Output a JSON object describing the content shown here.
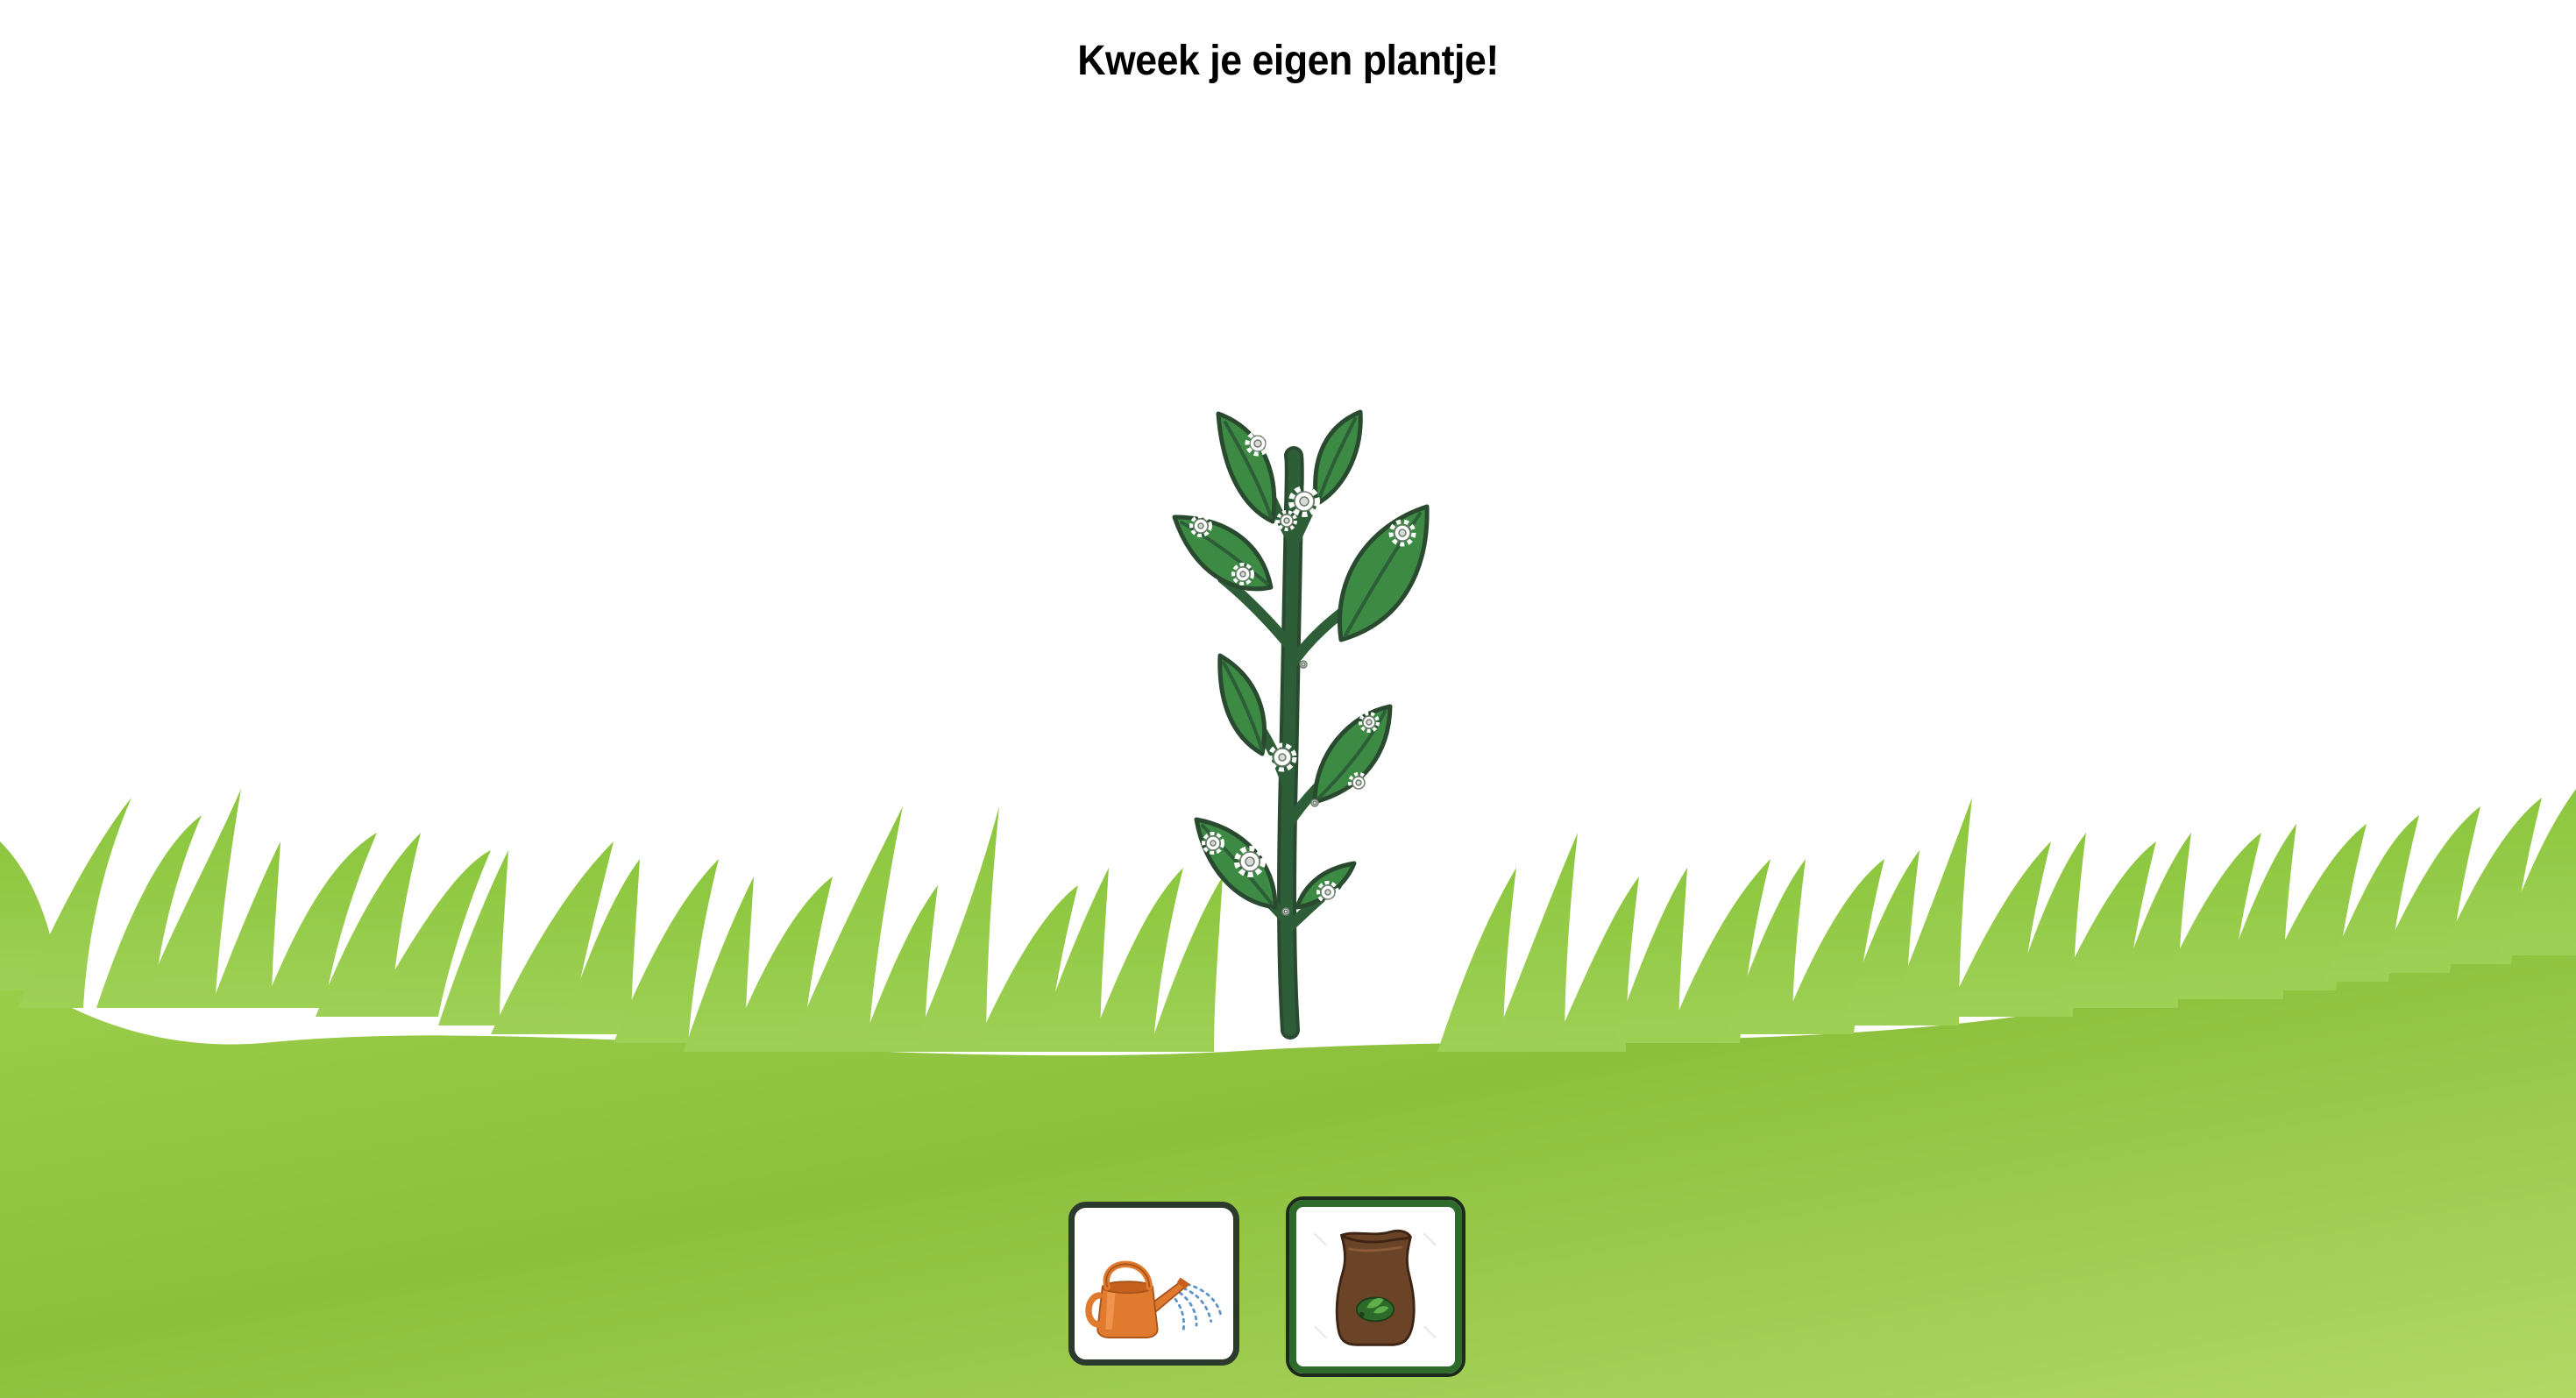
{
  "title": "Kweek je eigen plantje!",
  "colors": {
    "grass_light": "#b4dc6a",
    "grass_dark": "#7fb42c",
    "leaf": "#3d8a45",
    "stem": "#2d5e38",
    "outline": "#2a4a30",
    "flower": "#ffffff",
    "watering_can": "#e07a2e",
    "soil_bag": "#6b4428"
  },
  "tools": [
    {
      "name": "watering-can",
      "icon": "watering-can-icon",
      "selected": false
    },
    {
      "name": "soil-bag",
      "icon": "soil-bag-icon",
      "selected": true
    }
  ]
}
